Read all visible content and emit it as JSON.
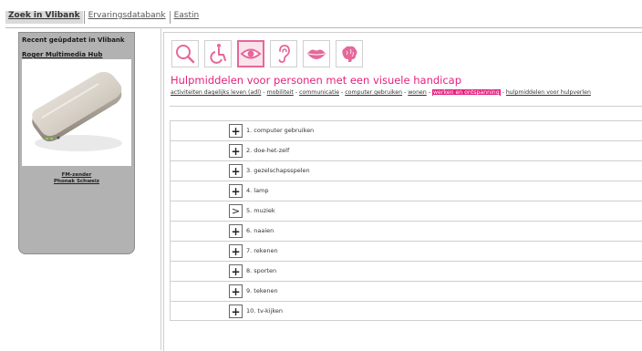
{
  "topnav": {
    "tabs": [
      {
        "label": "Zoek in Vlibank",
        "active": true
      },
      {
        "label": "Ervaringsdatabank",
        "active": false
      },
      {
        "label": "Eastin",
        "active": false
      }
    ]
  },
  "sidebar": {
    "heading": "Recent geüpdatet in Vlibank",
    "product_title": "Roger Multimedia Hub",
    "caption_line1": "FM-zender",
    "caption_line2": "Phonak Schweiz"
  },
  "main": {
    "icons": [
      {
        "name": "search-icon",
        "selected": false
      },
      {
        "name": "wheelchair-icon",
        "selected": false
      },
      {
        "name": "eye-icon",
        "selected": true
      },
      {
        "name": "ear-icon",
        "selected": false
      },
      {
        "name": "lips-icon",
        "selected": false
      },
      {
        "name": "brain-icon",
        "selected": false
      }
    ],
    "title": "Hulpmiddelen voor personen met een visuele handicap",
    "breadcrumb": {
      "items": [
        "activiteiten dagelijks leven (adl)",
        "mobiliteit",
        "communicatie",
        "computer gebruiken",
        "wonen",
        "werken en ontspanning",
        "hulpmiddelen voor hulpverlen"
      ],
      "separator": "-",
      "active_index": 5
    },
    "categories": [
      {
        "toggle": "+",
        "label": "1. computer gebruiken"
      },
      {
        "toggle": "+",
        "label": "2. doe-het-zelf"
      },
      {
        "toggle": "+",
        "label": "3. gezelschapsspelen"
      },
      {
        "toggle": "+",
        "label": "4. lamp"
      },
      {
        "toggle": ">",
        "label": "5. muziek"
      },
      {
        "toggle": "+",
        "label": "6. naaien"
      },
      {
        "toggle": "+",
        "label": "7. rekenen"
      },
      {
        "toggle": "+",
        "label": "8. sporten"
      },
      {
        "toggle": "+",
        "label": "9. tekenen"
      },
      {
        "toggle": "+",
        "label": "10. tv-kijken"
      }
    ]
  },
  "colors": {
    "accent": "#e6207f",
    "icon_pink": "#e5689a",
    "sidebar_bg": "#b2b2b2"
  }
}
